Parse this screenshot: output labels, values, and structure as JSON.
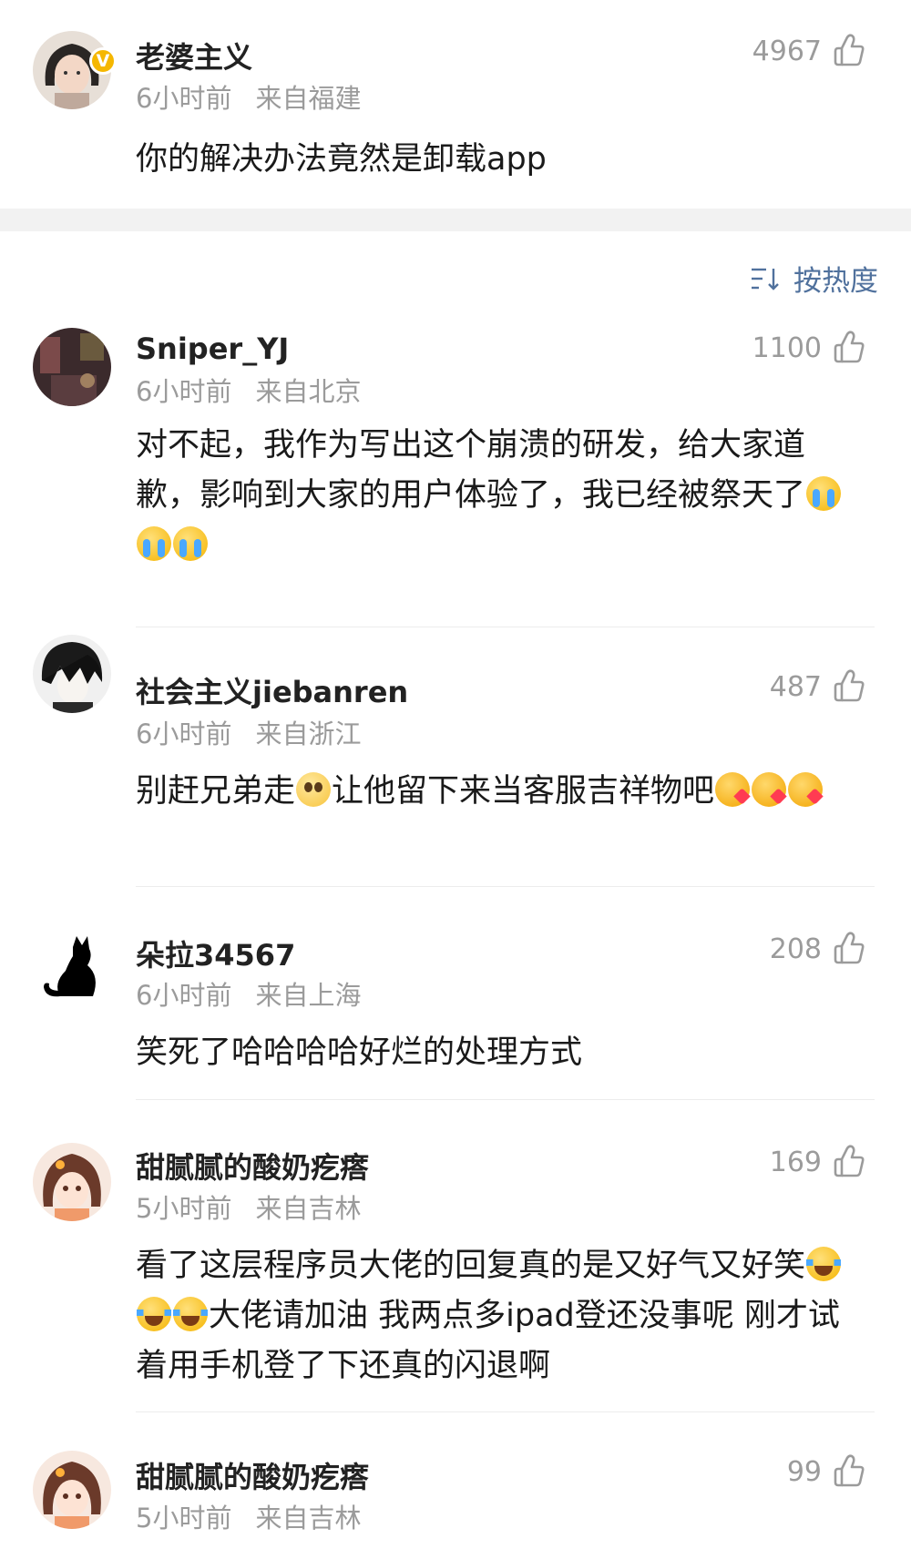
{
  "top_comment": {
    "username": "老婆主义",
    "time": "6小时前",
    "location": "来自福建",
    "likes": "4967",
    "text": "你的解决办法竟然是卸载app",
    "badge": "V",
    "avatar_icon": "woman-photo-avatar"
  },
  "sort": {
    "label": "按热度",
    "icon": "sort-icon"
  },
  "comments": [
    {
      "username": "Sniper_YJ",
      "time": "6小时前",
      "location": "来自北京",
      "likes": "1100",
      "text_1": "对不起，我作为写出这个崩溃的研发，给大家道歉，影响到大家的用户体验了，我已经被祭天了",
      "emoji": [
        "crying-emoji",
        "crying-emoji",
        "crying-emoji"
      ],
      "avatar_icon": "dark-room-avatar"
    },
    {
      "username": "社会主义jiebanren",
      "time": "6小时前",
      "location": "来自浙江",
      "likes": "487",
      "text_1": "别赶兄弟走",
      "text_2": "让他留下来当客服吉祥物吧",
      "emoji": [
        "pleading-emoji",
        "blow-kiss-emoji",
        "blow-kiss-emoji",
        "blow-kiss-emoji"
      ],
      "avatar_icon": "anime-boy-avatar"
    },
    {
      "username": "朵拉34567",
      "time": "6小时前",
      "location": "来自上海",
      "likes": "208",
      "text_1": "笑死了哈哈哈哈好烂的处理方式",
      "avatar_icon": "black-cat-avatar"
    },
    {
      "username": "甜腻腻的酸奶疙瘩",
      "time": "5小时前",
      "location": "来自吉林",
      "likes": "169",
      "text_1": "看了这层程序员大佬的回复真的是又好气又好笑",
      "text_2": "大佬请加油 我两点多ipad登还没事呢 刚才试着用手机登了下还真的闪退啊",
      "emoji": [
        "laughing-crying-emoji",
        "laughing-crying-emoji",
        "laughing-crying-emoji"
      ],
      "avatar_icon": "anime-girl-avatar"
    },
    {
      "username": "甜腻腻的酸奶疙瘩",
      "time": "5小时前",
      "location": "来自吉林",
      "likes": "99",
      "avatar_icon": "anime-girl-avatar"
    }
  ],
  "colors": {
    "meta_gray": "#9b9b9b",
    "link_blue": "#50719d",
    "badge_gold": "#f5b700",
    "band_gray": "#f2f2f2"
  },
  "like_icon": "thumbs-up-icon"
}
